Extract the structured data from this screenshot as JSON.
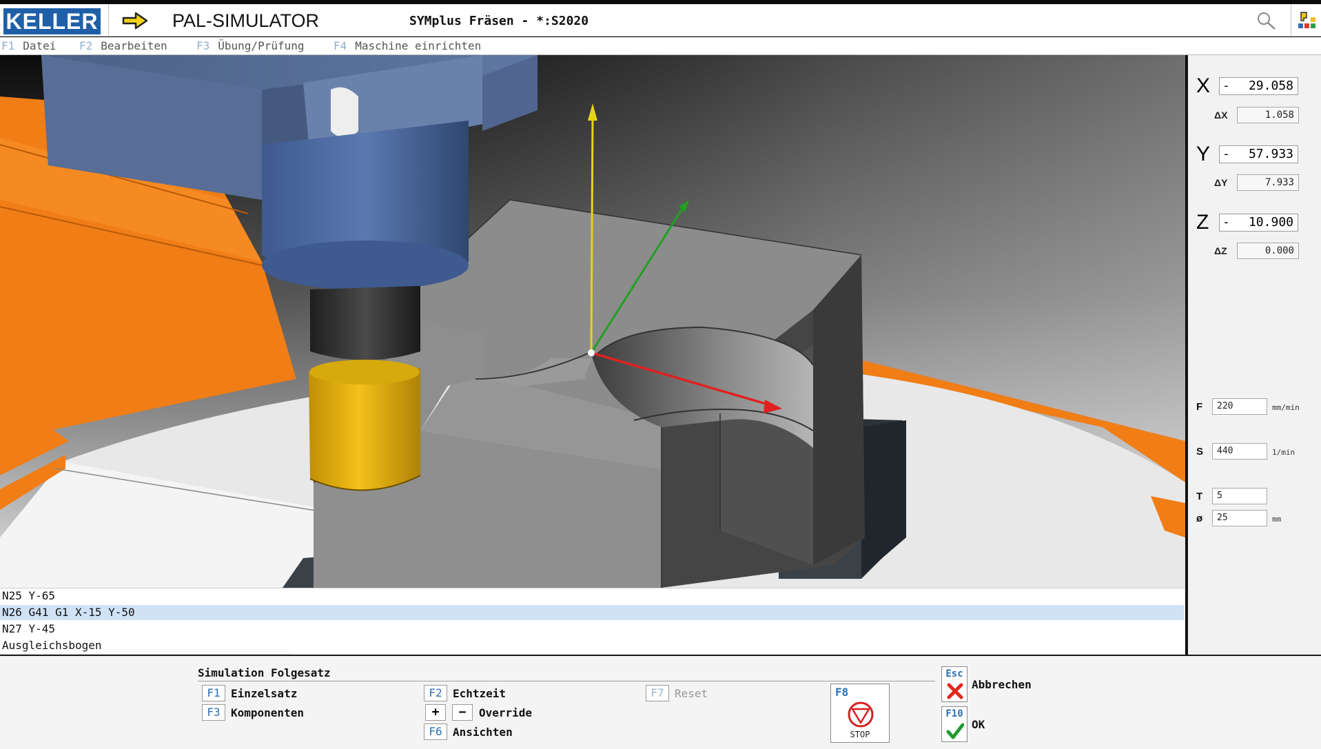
{
  "titlebar": {
    "logo": "KELLER",
    "app_title": "PAL-SIMULATOR",
    "doc_title": "SYMplus Fräsen - *:S2020"
  },
  "menu": [
    {
      "key": "F1",
      "label": "Datei"
    },
    {
      "key": "F2",
      "label": "Bearbeiten"
    },
    {
      "key": "F3",
      "label": "Übung/Prüfung"
    },
    {
      "key": "F4",
      "label": "Maschine einrichten"
    }
  ],
  "axes": {
    "x": {
      "label": "X",
      "sign": "-",
      "value": "29.058",
      "delta_label": "ΔX",
      "delta": "1.058"
    },
    "y": {
      "label": "Y",
      "sign": "-",
      "value": "57.933",
      "delta_label": "ΔY",
      "delta": "7.933"
    },
    "z": {
      "label": "Z",
      "sign": "-",
      "value": "10.900",
      "delta_label": "ΔZ",
      "delta": "0.000"
    }
  },
  "params": {
    "f": {
      "label": "F",
      "value": "220",
      "unit": "mm/min"
    },
    "s": {
      "label": "S",
      "value": "440",
      "unit": "1/min"
    },
    "t": {
      "label": "T",
      "value": "5"
    },
    "d": {
      "label": "ø",
      "value": "25",
      "unit": "mm"
    }
  },
  "nc_program": [
    {
      "text": "N25 Y-65",
      "selected": false
    },
    {
      "text": "N26 G41 G1 X-15 Y-50",
      "selected": true
    },
    {
      "text": "N27 Y-45",
      "selected": false
    },
    {
      "text": "Ausgleichsbogen",
      "selected": false
    }
  ],
  "softkeys": {
    "title": "Simulation Folgesatz",
    "f1": {
      "key": "F1",
      "label": "Einzelsatz"
    },
    "f3": {
      "key": "F3",
      "label": "Komponenten"
    },
    "f2": {
      "key": "F2",
      "label": "Echtzeit"
    },
    "override": {
      "plus": "+",
      "minus": "−",
      "label": "Override"
    },
    "f6": {
      "key": "F6",
      "label": "Ansichten"
    },
    "f7": {
      "key": "F7",
      "label": "Reset"
    },
    "stop": {
      "key": "F8",
      "label": "STOP"
    },
    "esc": {
      "key": "Esc",
      "label": "Abbrechen"
    },
    "ok": {
      "key": "F10",
      "label": "OK"
    }
  },
  "colors": {
    "accent": "#2a6fb5",
    "fixture_orange": "#f07d16",
    "tool_holder_blue": "#4e6796",
    "tool_yellow": "#e8b612",
    "axis_x": "#e02020",
    "axis_y": "#20a020",
    "axis_z": "#e8d21a"
  },
  "icons": [
    "arrow-right-icon",
    "search-icon",
    "tools-icon",
    "stop-icon",
    "cancel-x-icon",
    "ok-check-icon"
  ]
}
